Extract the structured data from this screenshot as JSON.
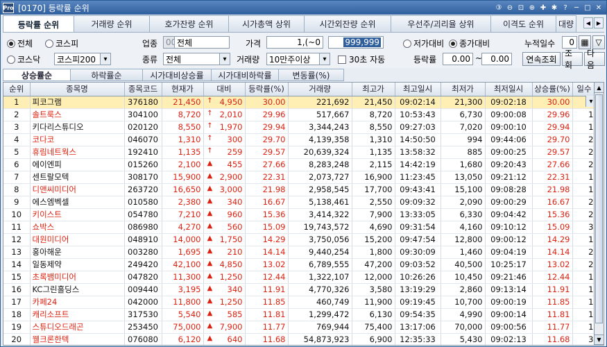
{
  "window": {
    "title": "[0170] 등락률 순위"
  },
  "tabs": [
    "등락률 순위",
    "거래량 순위",
    "호가잔량 순위",
    "시가총액 상위",
    "시간외잔량 순위",
    "우선주/괴리율 상위",
    "이격도 순위",
    "대량"
  ],
  "market": {
    "all": "전체",
    "kospi": "코스피",
    "kosdaq": "코스닥",
    "kospi200": "코스피200"
  },
  "filters": {
    "industry_label": "업종",
    "industry_code": "0000",
    "industry_name": "전체",
    "price_label": "가격",
    "price_from": "1,(~0",
    "price_to": "999,999",
    "kind_label": "종류",
    "kind_value": "전체",
    "volume_label": "거래량",
    "volume_value": "10만주이상",
    "auto_label": "30초 자동",
    "low_label": "저가대비",
    "close_label": "종가대비",
    "cum_days_label": "누적일수",
    "cum_days_value": "0",
    "rate_label": "등락률",
    "rate_from": "0.00",
    "rate_to": "0.00",
    "tilde": "~",
    "continuous_btn": "연속조회",
    "query_btn": "조회",
    "next_btn": "다음"
  },
  "subtabs": [
    "상승률순",
    "하락률순",
    "시가대비상승률",
    "시가대비하락률",
    "변동률(%)"
  ],
  "columns": [
    "순위",
    "종목명",
    "종목코드",
    "현재가",
    "대비",
    "등락률(%)",
    "거래량",
    "최고가",
    "최고일시",
    "최저가",
    "최저일시",
    "상승률(%)",
    "일수"
  ],
  "rows": [
    {
      "rank": "1",
      "name": "피코그램",
      "code": "376180",
      "price": "21,450",
      "sign": "↑",
      "diff": "4,950",
      "rate": "30.00",
      "volume": "221,692",
      "high": "21,450",
      "high_time": "09:02:14",
      "low": "21,300",
      "low_time": "09:02:18",
      "rise": "30.00",
      "days": "3",
      "sel": true
    },
    {
      "rank": "2",
      "name": "솔트룩스",
      "code": "304100",
      "price": "8,720",
      "sign": "↑",
      "diff": "2,010",
      "rate": "29.96",
      "volume": "517,667",
      "high": "8,720",
      "high_time": "10:53:43",
      "low": "6,730",
      "low_time": "09:00:08",
      "rise": "29.96",
      "days": "1"
    },
    {
      "rank": "3",
      "name": "키다리스튜디오",
      "code": "020120",
      "price": "8,550",
      "sign": "↑",
      "diff": "1,970",
      "rate": "29.94",
      "volume": "3,344,243",
      "high": "8,550",
      "high_time": "09:27:03",
      "low": "7,020",
      "low_time": "09:00:10",
      "rise": "29.94",
      "days": "1"
    },
    {
      "rank": "4",
      "name": "코다코",
      "code": "046070",
      "price": "1,310",
      "sign": "↑",
      "diff": "300",
      "rate": "29.70",
      "volume": "4,139,358",
      "high": "1,310",
      "high_time": "14:50:50",
      "low": "994",
      "low_time": "09:44:06",
      "rise": "29.70",
      "days": "2"
    },
    {
      "rank": "5",
      "name": "휴림네트웍스",
      "code": "192410",
      "price": "1,135",
      "sign": "↑",
      "diff": "259",
      "rate": "29.57",
      "volume": "20,639,324",
      "high": "1,135",
      "high_time": "13:58:32",
      "low": "885",
      "low_time": "09:00:25",
      "rise": "29.57",
      "days": "2"
    },
    {
      "rank": "6",
      "name": "에이엔피",
      "code": "015260",
      "price": "2,100",
      "sign": "▲",
      "diff": "455",
      "rate": "27.66",
      "volume": "8,283,248",
      "high": "2,115",
      "high_time": "14:42:19",
      "low": "1,680",
      "low_time": "09:20:43",
      "rise": "27.66",
      "days": "2"
    },
    {
      "rank": "7",
      "name": "센트랄모텍",
      "code": "308170",
      "price": "15,900",
      "sign": "▲",
      "diff": "2,900",
      "rate": "22.31",
      "volume": "2,073,727",
      "high": "16,900",
      "high_time": "11:23:45",
      "low": "13,050",
      "low_time": "09:21:12",
      "rise": "22.31",
      "days": "1"
    },
    {
      "rank": "8",
      "name": "디앤씨미디어",
      "code": "263720",
      "price": "16,650",
      "sign": "▲",
      "diff": "3,000",
      "rate": "21.98",
      "volume": "2,958,545",
      "high": "17,700",
      "high_time": "09:43:41",
      "low": "15,100",
      "low_time": "09:08:28",
      "rise": "21.98",
      "days": "1"
    },
    {
      "rank": "9",
      "name": "에스엠벡셀",
      "code": "010580",
      "price": "2,380",
      "sign": "▲",
      "diff": "340",
      "rate": "16.67",
      "volume": "5,138,461",
      "high": "2,550",
      "high_time": "09:09:32",
      "low": "2,090",
      "low_time": "09:00:29",
      "rise": "16.67",
      "days": "2"
    },
    {
      "rank": "10",
      "name": "키이스트",
      "code": "054780",
      "price": "7,210",
      "sign": "▲",
      "diff": "960",
      "rate": "15.36",
      "volume": "3,414,322",
      "high": "7,900",
      "high_time": "13:33:05",
      "low": "6,330",
      "low_time": "09:04:42",
      "rise": "15.36",
      "days": "2"
    },
    {
      "rank": "11",
      "name": "쇼박스",
      "code": "086980",
      "price": "4,270",
      "sign": "▲",
      "diff": "560",
      "rate": "15.09",
      "volume": "19,743,572",
      "high": "4,690",
      "high_time": "09:31:54",
      "low": "4,160",
      "low_time": "09:10:12",
      "rise": "15.09",
      "days": "3"
    },
    {
      "rank": "12",
      "name": "대원미디어",
      "code": "048910",
      "price": "14,000",
      "sign": "▲",
      "diff": "1,750",
      "rate": "14.29",
      "volume": "3,750,056",
      "high": "15,200",
      "high_time": "09:47:54",
      "low": "12,800",
      "low_time": "09:00:12",
      "rise": "14.29",
      "days": "1"
    },
    {
      "rank": "13",
      "name": "홍아해운",
      "code": "003280",
      "price": "1,695",
      "sign": "▲",
      "diff": "210",
      "rate": "14.14",
      "volume": "9,440,254",
      "high": "1,800",
      "high_time": "09:30:09",
      "low": "1,460",
      "low_time": "09:04:19",
      "rise": "14.14",
      "days": "2"
    },
    {
      "rank": "14",
      "name": "일동제약",
      "code": "249420",
      "price": "42,100",
      "sign": "▲",
      "diff": "4,850",
      "rate": "13.02",
      "volume": "6,789,555",
      "high": "47,200",
      "high_time": "09:03:52",
      "low": "40,500",
      "low_time": "10:25:17",
      "rise": "13.02",
      "days": "2"
    },
    {
      "rank": "15",
      "name": "초록뱀미디어",
      "code": "047820",
      "price": "11,300",
      "sign": "▲",
      "diff": "1,250",
      "rate": "12.44",
      "volume": "1,322,107",
      "high": "12,000",
      "high_time": "10:26:26",
      "low": "10,450",
      "low_time": "09:21:46",
      "rise": "12.44",
      "days": "1"
    },
    {
      "rank": "16",
      "name": "KC그린홀딩스",
      "code": "009440",
      "price": "3,195",
      "sign": "▲",
      "diff": "340",
      "rate": "11.91",
      "volume": "4,770,326",
      "high": "3,580",
      "high_time": "13:19:29",
      "low": "2,860",
      "low_time": "09:13:14",
      "rise": "11.91",
      "days": "1"
    },
    {
      "rank": "17",
      "name": "카페24",
      "code": "042000",
      "price": "11,800",
      "sign": "▲",
      "diff": "1,250",
      "rate": "11.85",
      "volume": "460,749",
      "high": "11,900",
      "high_time": "09:19:45",
      "low": "10,700",
      "low_time": "09:00:19",
      "rise": "11.85",
      "days": "1"
    },
    {
      "rank": "18",
      "name": "캐리소프트",
      "code": "317530",
      "price": "5,540",
      "sign": "▲",
      "diff": "585",
      "rate": "11.81",
      "volume": "1,299,472",
      "high": "6,130",
      "high_time": "09:54:35",
      "low": "4,990",
      "low_time": "09:00:14",
      "rise": "11.81",
      "days": "1"
    },
    {
      "rank": "19",
      "name": "스튜디오드래곤",
      "code": "253450",
      "price": "75,000",
      "sign": "▲",
      "diff": "7,900",
      "rate": "11.77",
      "volume": "769,944",
      "high": "75,400",
      "high_time": "13:17:06",
      "low": "70,000",
      "low_time": "09:00:56",
      "rise": "11.77",
      "days": "1"
    },
    {
      "rank": "20",
      "name": "웰크론한텍",
      "code": "076080",
      "price": "6,120",
      "sign": "▲",
      "diff": "640",
      "rate": "11.68",
      "volume": "54,873,923",
      "high": "6,900",
      "high_time": "12:35:33",
      "low": "5,430",
      "low_time": "09:02:13",
      "rise": "11.68",
      "days": "3"
    }
  ],
  "colors": {
    "up": "#d21",
    "selected_row": "#ffefb5",
    "title_bar": "#2f5f9d"
  }
}
